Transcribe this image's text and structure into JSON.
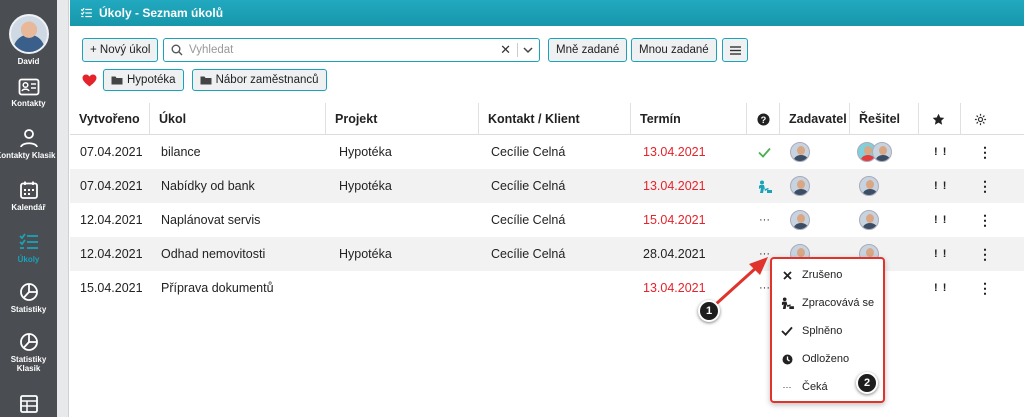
{
  "sidebar": {
    "user_name": "David",
    "items": [
      {
        "label": "Kontakty",
        "icon": "contact-card-icon"
      },
      {
        "label": "Kontakty Klasik",
        "icon": "person-icon"
      },
      {
        "label": "Kalendář",
        "icon": "calendar-icon"
      },
      {
        "label": "Úkoly",
        "icon": "task-list-icon"
      },
      {
        "label": "Statistiky",
        "icon": "pie-chart-icon"
      },
      {
        "label": "Statistiky Klasik",
        "icon": "pie-chart-icon"
      }
    ]
  },
  "header": {
    "title": "Úkoly - Seznam úkolů",
    "icon": "task-list-icon"
  },
  "toolbar": {
    "new_task": "+ Nový úkol",
    "search_placeholder": "Vyhledat",
    "assigned_to_me": "Mně zadané",
    "assigned_by_me": "Mnou zadané"
  },
  "tags": [
    {
      "label": "Hypotéka",
      "icon": "folder-icon"
    },
    {
      "label": "Nábor zaměstnanců",
      "icon": "folder-icon"
    }
  ],
  "table": {
    "columns": [
      "Vytvořeno",
      "Úkol",
      "Projekt",
      "Kontakt / Klient",
      "Termín",
      "Zadavatel",
      "Řešitel"
    ],
    "rows": [
      {
        "created": "07.04.2021",
        "task": "bilance",
        "project": "Hypotéka",
        "contact": "Cecílie Celná",
        "deadline": "13.04.2021",
        "deadline_overdue": true,
        "status": "done",
        "priority": "! !"
      },
      {
        "created": "07.04.2021",
        "task": "Nabídky od bank",
        "project": "Hypotéka",
        "contact": "Cecílie Celná",
        "deadline": "13.04.2021",
        "deadline_overdue": true,
        "status": "in-progress",
        "priority": "! !"
      },
      {
        "created": "12.04.2021",
        "task": "Naplánovat servis",
        "project": "",
        "contact": "Cecílie Celná",
        "deadline": "15.04.2021",
        "deadline_overdue": true,
        "status": "waiting",
        "priority": "! !"
      },
      {
        "created": "12.04.2021",
        "task": "Odhad nemovitosti",
        "project": "Hypotéka",
        "contact": "Cecílie Celná",
        "deadline": "28.04.2021",
        "deadline_overdue": false,
        "status": "waiting",
        "priority": "! !"
      },
      {
        "created": "15.04.2021",
        "task": "Příprava dokumentů",
        "project": "",
        "contact": "",
        "deadline": "13.04.2021",
        "deadline_overdue": true,
        "status": "waiting",
        "priority": "! !"
      }
    ]
  },
  "status_menu": {
    "items": [
      {
        "label": "Zrušeno",
        "icon": "close-icon"
      },
      {
        "label": "Zpracovává se",
        "icon": "worker-icon"
      },
      {
        "label": "Splněno",
        "icon": "checkmark-icon"
      },
      {
        "label": "Odloženo",
        "icon": "clock-icon"
      },
      {
        "label": "Čeká",
        "icon": "ellipsis-icon"
      }
    ]
  },
  "callouts": [
    "1",
    "2"
  ],
  "colors": {
    "accent": "#1aa3b8",
    "overdue": "#e4232b",
    "done": "#4caf50",
    "annotation": "#e0332c",
    "sidebar": "#4a4d52"
  }
}
